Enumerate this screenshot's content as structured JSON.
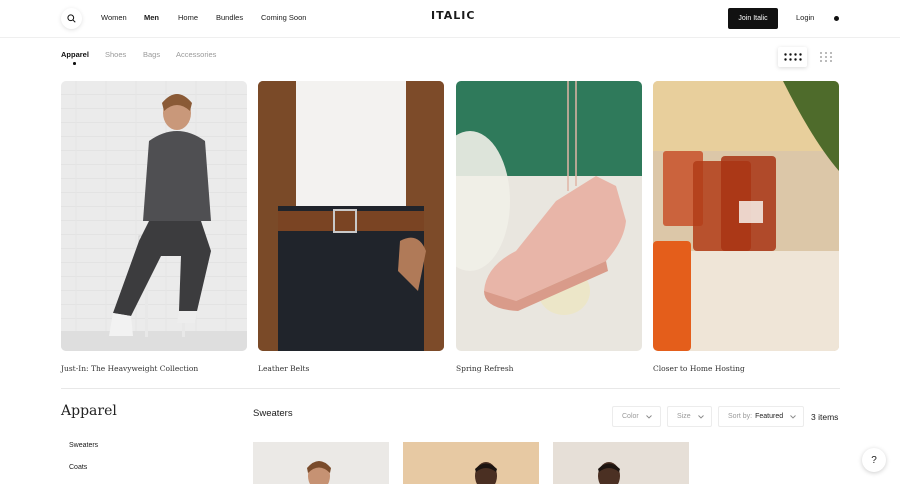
{
  "header": {
    "nav": [
      "Women",
      "Men",
      "Home",
      "Bundles",
      "Coming Soon"
    ],
    "logo": "ITALIC",
    "join_label": "Join Italic",
    "login_label": "Login"
  },
  "category_tabs": [
    "Apparel",
    "Shoes",
    "Bags",
    "Accessories"
  ],
  "active_category": "Apparel",
  "features": [
    {
      "caption": "Just-In: The Heavyweight Collection"
    },
    {
      "caption": "Leather Belts"
    },
    {
      "caption": "Spring Refresh"
    },
    {
      "caption": "Closer to Home Hosting"
    }
  ],
  "section": {
    "title": "Apparel",
    "side_links": [
      "Sweaters",
      "Coats"
    ],
    "subtitle": "Sweaters",
    "filters": {
      "color": "Color",
      "size": "Size",
      "sort_label": "Sort by:",
      "sort_value": "Featured"
    },
    "count": "3 items"
  },
  "help_label": "?",
  "colors": {
    "accent": "#111111",
    "muted": "#9a9a9a"
  }
}
